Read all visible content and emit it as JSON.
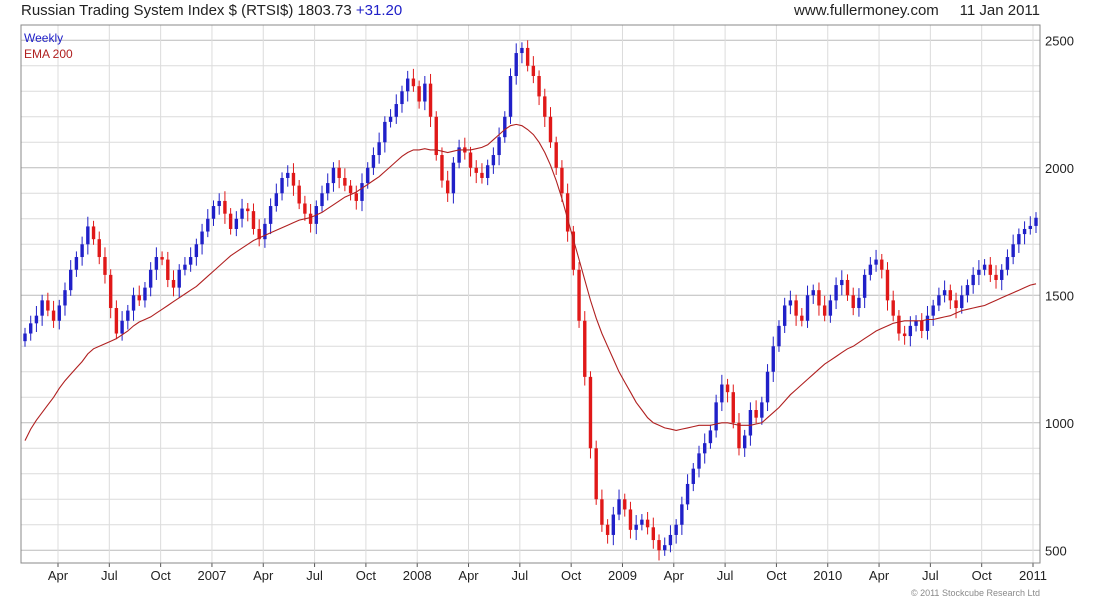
{
  "header": {
    "title": "Russian Trading System Index $ (RTSI$)",
    "last_value": "1803.73",
    "change": "+31.20",
    "site": "www.fullermoney.com",
    "date": "11 Jan 2011"
  },
  "legend": {
    "series1": "Weekly",
    "series2": "EMA 200"
  },
  "footer": {
    "copyright": "© 2011 Stockcube Research Ltd"
  },
  "colors": {
    "up": "#2020c8",
    "down": "#e01818",
    "ema": "#b02020",
    "grid": "#dcdcdc"
  },
  "chart_data": {
    "type": "candlestick",
    "x_tick_labels": [
      "Apr",
      "Jul",
      "Oct",
      "2007",
      "Apr",
      "Jul",
      "Oct",
      "2008",
      "Apr",
      "Jul",
      "Oct",
      "2009",
      "Apr",
      "Jul",
      "Oct",
      "2010",
      "Apr",
      "Jul",
      "Oct",
      "2011"
    ],
    "y_ticks": [
      500,
      1000,
      1500,
      2000,
      2500
    ],
    "ylim": [
      450,
      2560
    ],
    "y_axis_side": "right",
    "grid": true,
    "weekly_close": [
      1350,
      1390,
      1420,
      1480,
      1440,
      1400,
      1460,
      1520,
      1600,
      1650,
      1700,
      1770,
      1720,
      1650,
      1580,
      1450,
      1350,
      1400,
      1440,
      1500,
      1480,
      1530,
      1600,
      1650,
      1640,
      1560,
      1530,
      1600,
      1620,
      1650,
      1700,
      1750,
      1800,
      1850,
      1870,
      1820,
      1760,
      1800,
      1840,
      1830,
      1760,
      1720,
      1780,
      1850,
      1900,
      1960,
      1980,
      1930,
      1860,
      1820,
      1780,
      1850,
      1900,
      1940,
      2000,
      1960,
      1930,
      1900,
      1870,
      1940,
      2000,
      2050,
      2100,
      2180,
      2200,
      2250,
      2300,
      2350,
      2320,
      2260,
      2330,
      2200,
      2050,
      1950,
      1900,
      2020,
      2080,
      2060,
      2000,
      1980,
      1960,
      2010,
      2050,
      2120,
      2200,
      2360,
      2450,
      2470,
      2400,
      2360,
      2280,
      2200,
      2100,
      2000,
      1900,
      1750,
      1600,
      1400,
      1180,
      900,
      700,
      600,
      560,
      640,
      700,
      660,
      580,
      600,
      620,
      590,
      540,
      500,
      520,
      560,
      600,
      680,
      760,
      820,
      880,
      920,
      970,
      1080,
      1150,
      1120,
      1000,
      900,
      950,
      1050,
      1020,
      1080,
      1200,
      1300,
      1380,
      1460,
      1480,
      1420,
      1400,
      1500,
      1520,
      1460,
      1420,
      1480,
      1540,
      1560,
      1500,
      1450,
      1490,
      1580,
      1620,
      1640,
      1600,
      1480,
      1420,
      1350,
      1340,
      1380,
      1400,
      1360,
      1420,
      1460,
      1500,
      1520,
      1480,
      1450,
      1500,
      1540,
      1580,
      1600,
      1620,
      1580,
      1560,
      1600,
      1650,
      1700,
      1740,
      1760,
      1772,
      1804
    ],
    "ema200": [
      930,
      975,
      1010,
      1040,
      1070,
      1100,
      1135,
      1165,
      1190,
      1215,
      1240,
      1270,
      1290,
      1300,
      1310,
      1320,
      1330,
      1345,
      1360,
      1380,
      1395,
      1405,
      1415,
      1430,
      1445,
      1460,
      1475,
      1490,
      1505,
      1520,
      1535,
      1555,
      1575,
      1595,
      1615,
      1635,
      1655,
      1670,
      1685,
      1700,
      1715,
      1725,
      1735,
      1745,
      1755,
      1765,
      1775,
      1785,
      1795,
      1800,
      1805,
      1815,
      1825,
      1840,
      1855,
      1870,
      1885,
      1895,
      1905,
      1920,
      1935,
      1950,
      1965,
      1985,
      2005,
      2025,
      2045,
      2060,
      2070,
      2070,
      2075,
      2070,
      2070,
      2065,
      2060,
      2065,
      2070,
      2070,
      2070,
      2075,
      2080,
      2090,
      2110,
      2130,
      2150,
      2165,
      2170,
      2165,
      2150,
      2130,
      2100,
      2060,
      2010,
      1950,
      1880,
      1800,
      1720,
      1640,
      1560,
      1480,
      1410,
      1350,
      1300,
      1250,
      1200,
      1160,
      1120,
      1080,
      1050,
      1020,
      1000,
      990,
      980,
      975,
      970,
      975,
      980,
      985,
      990,
      990,
      990,
      995,
      1000,
      1000,
      995,
      990,
      990,
      990,
      995,
      1000,
      1020,
      1040,
      1060,
      1085,
      1110,
      1130,
      1150,
      1170,
      1190,
      1210,
      1230,
      1245,
      1260,
      1275,
      1290,
      1300,
      1315,
      1330,
      1345,
      1360,
      1370,
      1380,
      1390,
      1395,
      1400,
      1400,
      1400,
      1400,
      1405,
      1405,
      1410,
      1415,
      1420,
      1430,
      1440,
      1445,
      1450,
      1455,
      1460,
      1470,
      1480,
      1490,
      1500,
      1510,
      1520,
      1530,
      1540,
      1545
    ]
  }
}
